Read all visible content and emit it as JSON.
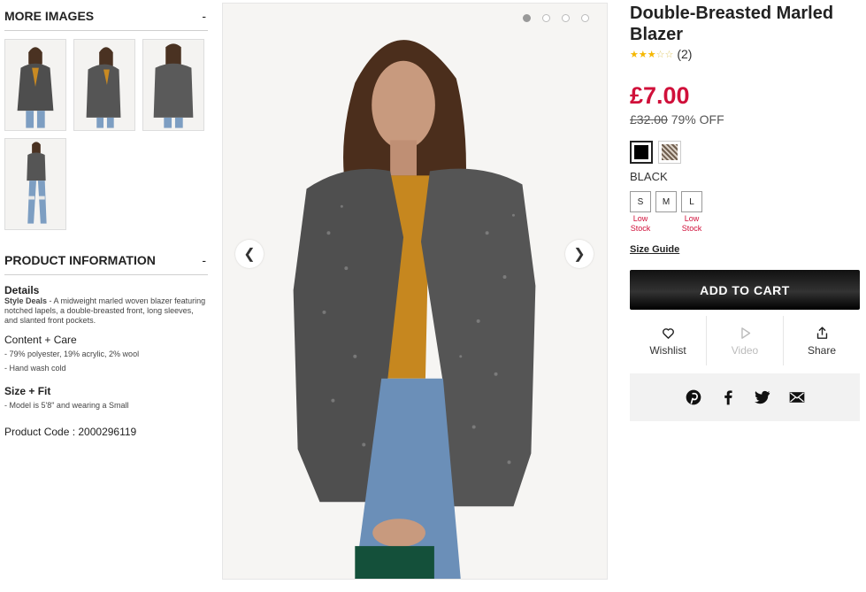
{
  "more_images": {
    "title": "MORE IMAGES",
    "toggle": "-"
  },
  "product_information": {
    "title": "PRODUCT INFORMATION",
    "toggle": "-",
    "details_heading": "Details",
    "style_label": "Style Deals",
    "style_text": " - A midweight marled woven blazer featuring notched lapels, a double-breasted front, long sleeves, and slanted front pockets.",
    "content_heading": "Content + Care",
    "content_lines": [
      "- 79% polyester, 19% acrylic, 2% wool",
      "- Hand wash cold"
    ],
    "fit_heading": "Size + Fit",
    "fit_lines": [
      "- Model is 5'8\" and wearing a Small"
    ],
    "product_code": "Product Code : 2000296119"
  },
  "gallery": {
    "prev_icon": "chevron-left-icon",
    "next_icon": "chevron-right-icon",
    "active_dot": 1,
    "dot_count": 4
  },
  "product": {
    "title": "Double-Breasted Marled Blazer",
    "rating": 3,
    "rating_max": 5,
    "review_count": "(2)",
    "price": "£7.00",
    "original_price": "£32.00",
    "discount": "79% OFF",
    "selected_color": "BLACK",
    "colors": [
      {
        "name": "black",
        "hex": "#000000"
      },
      {
        "name": "tweed",
        "hex": "#8a7b6e"
      }
    ],
    "sizes": [
      {
        "label": "S",
        "stock": "Low Stock"
      },
      {
        "label": "M",
        "stock": ""
      },
      {
        "label": "L",
        "stock": "Low Stock"
      }
    ],
    "size_guide": "Size Guide",
    "add_to_cart": "ADD TO CART",
    "actions": [
      {
        "label": "Wishlist",
        "icon": "heart-icon"
      },
      {
        "label": "Video",
        "icon": "play-icon"
      },
      {
        "label": "Share",
        "icon": "share-icon"
      }
    ],
    "social": [
      "pinterest-icon",
      "facebook-icon",
      "twitter-icon",
      "email-icon"
    ]
  },
  "colors": {
    "price_red": "#d0103a",
    "button_black": "#111111",
    "social_bg": "#f2f2f2"
  }
}
